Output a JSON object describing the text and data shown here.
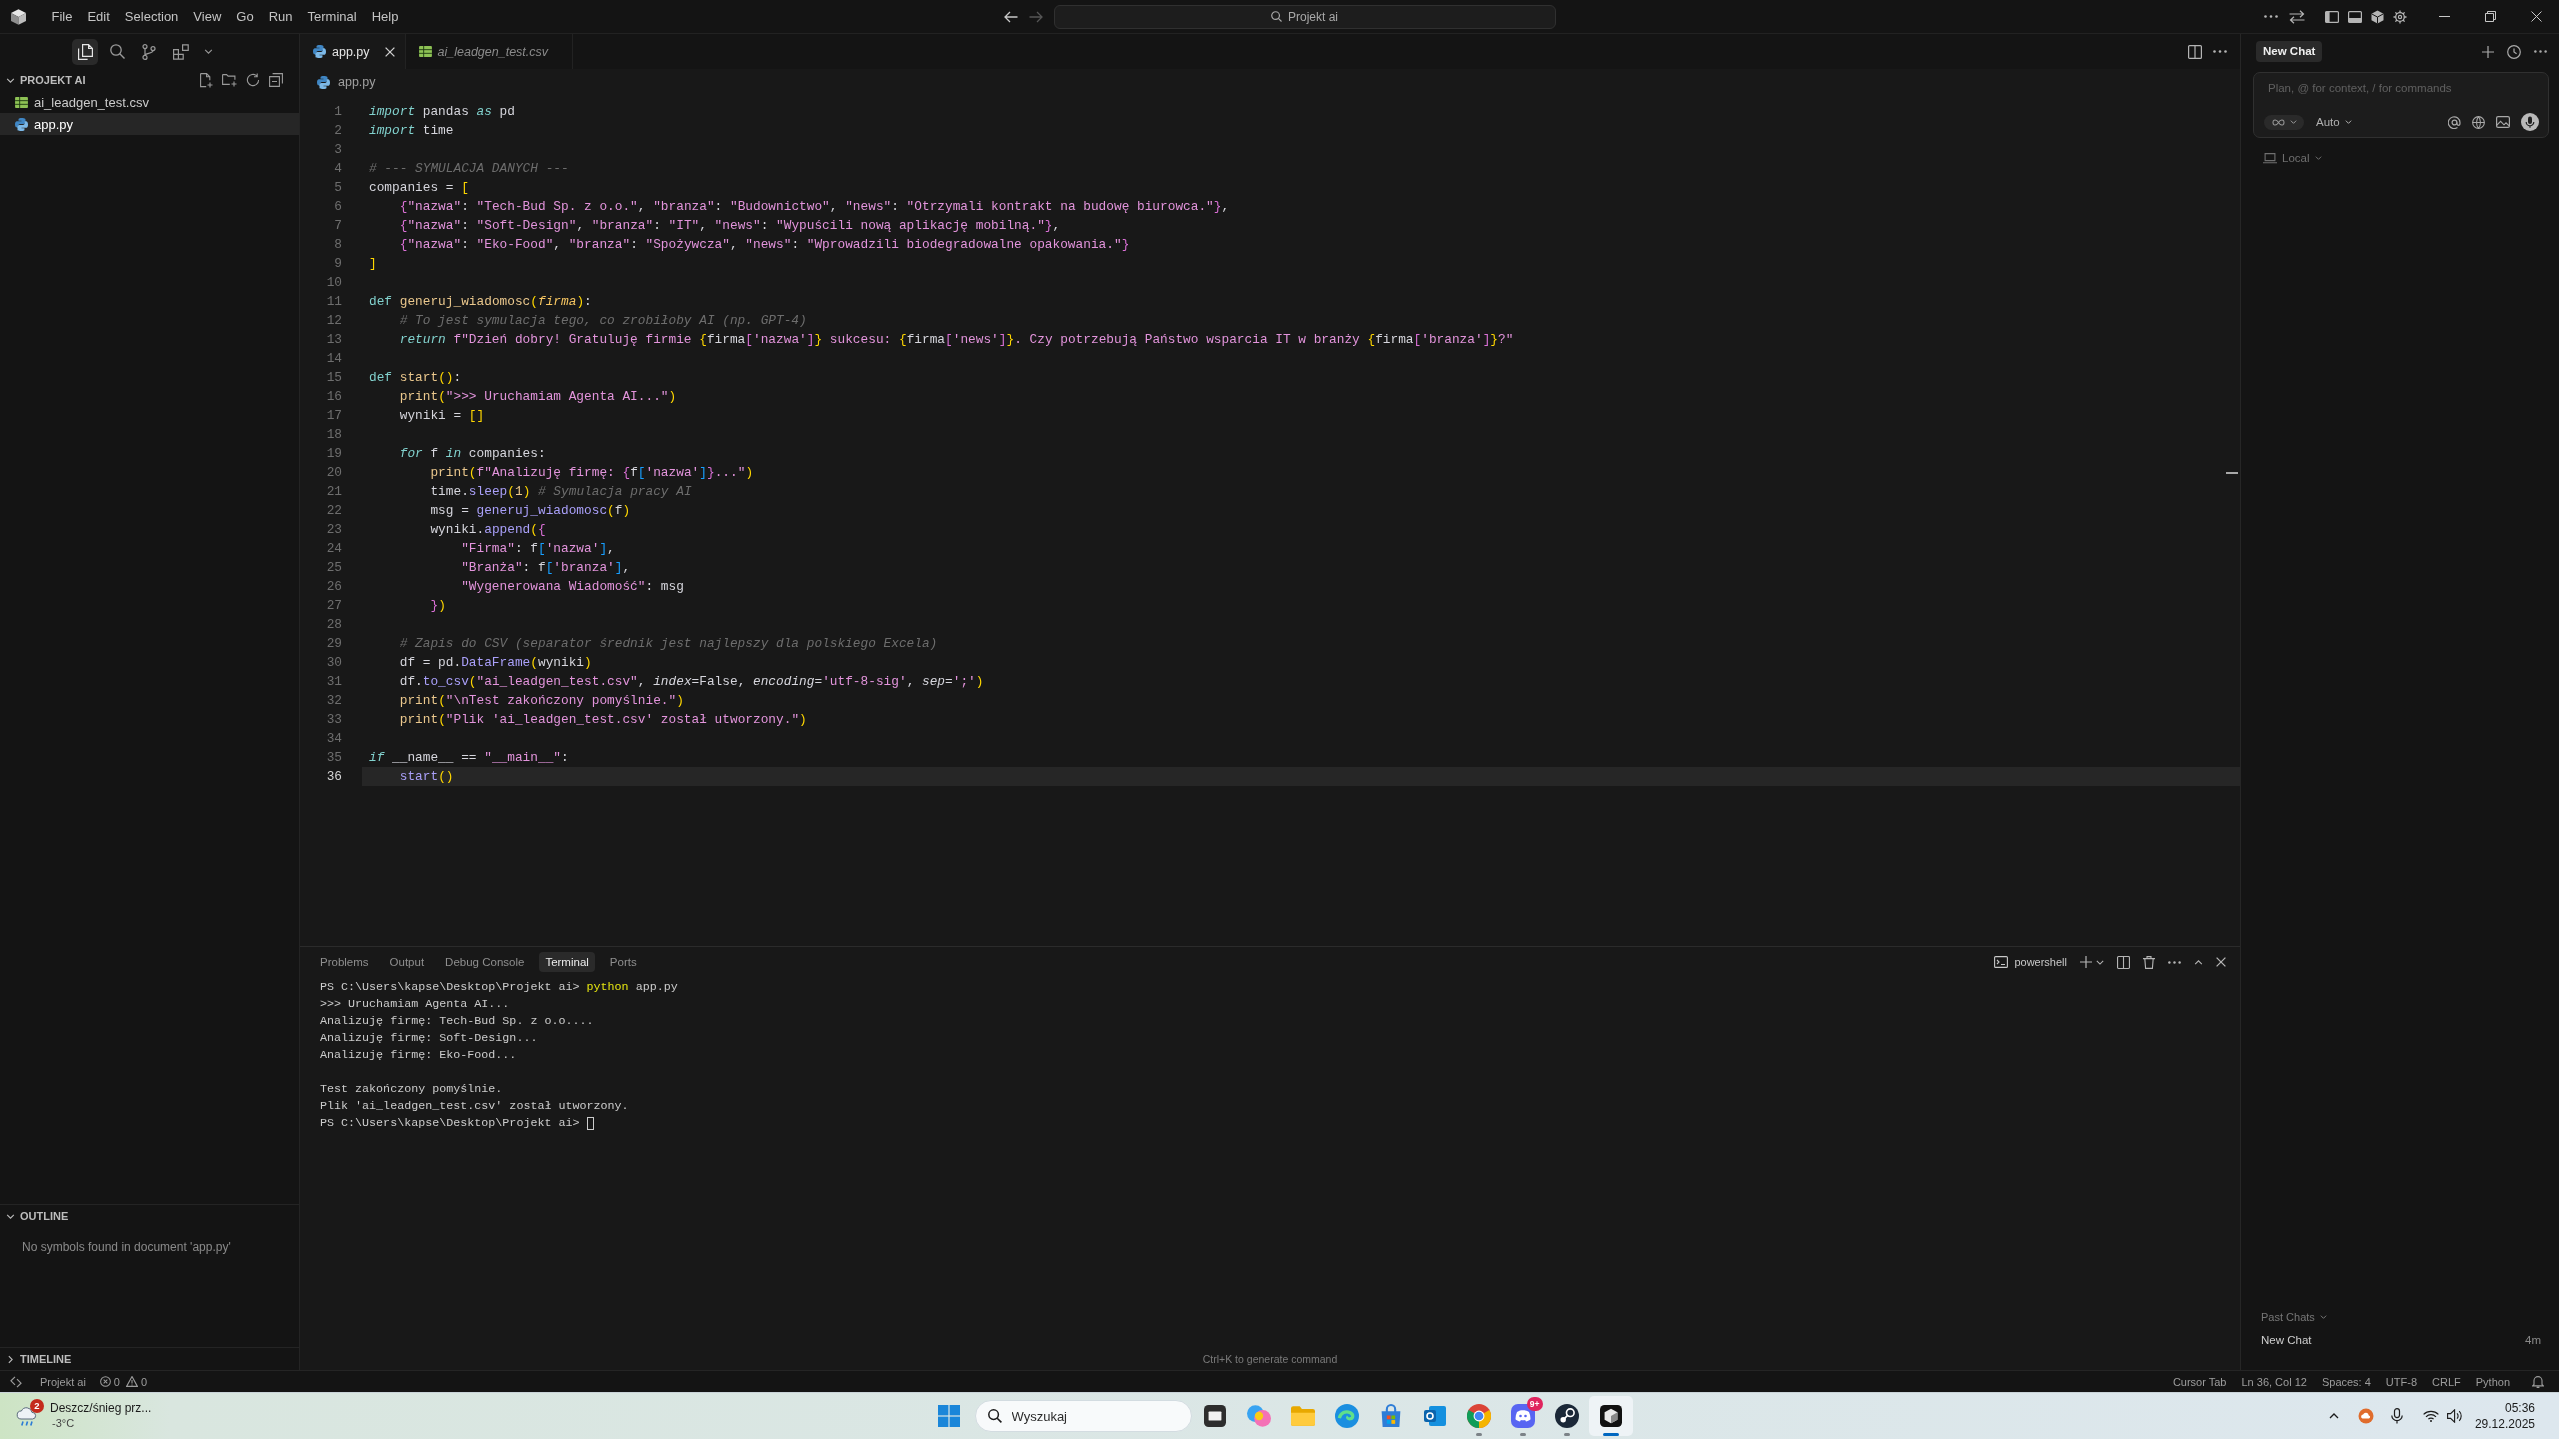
{
  "title_bar": {
    "menu": [
      "File",
      "Edit",
      "Selection",
      "View",
      "Go",
      "Run",
      "Terminal",
      "Help"
    ],
    "command_center": "Projekt ai"
  },
  "sidebar": {
    "views": [
      {
        "kind": "files",
        "selected": true
      },
      {
        "kind": "search",
        "selected": false
      },
      {
        "kind": "branch",
        "selected": false
      },
      {
        "kind": "blocks",
        "selected": false
      }
    ],
    "explorer": {
      "title": "PROJEKT AI",
      "expanded": true,
      "files": [
        {
          "name": "ai_leadgen_test.csv",
          "kind": "csv",
          "selected": false
        },
        {
          "name": "app.py",
          "kind": "python",
          "selected": true
        }
      ]
    },
    "outline": {
      "title": "OUTLINE",
      "expanded": true,
      "message": "No symbols found in document 'app.py'"
    },
    "timeline": {
      "title": "TIMELINE",
      "expanded": false
    }
  },
  "editor": {
    "tabs": [
      {
        "label": "app.py",
        "kind": "python",
        "selected": true,
        "preview": false
      },
      {
        "label": "ai_leadgen_test.csv",
        "kind": "csv",
        "selected": false,
        "preview": true
      }
    ],
    "breadcrumb": {
      "label": "app.py",
      "kind": "python"
    },
    "lines": [
      {
        "number": "1",
        "current": false,
        "tokens": [
          {
            "kind": "kw",
            "text": "import"
          },
          {
            "kind": "p",
            "text": " pandas "
          },
          {
            "kind": "kw",
            "text": "as"
          },
          {
            "kind": "p",
            "text": " pd"
          }
        ]
      },
      {
        "number": "2",
        "current": false,
        "tokens": [
          {
            "kind": "kw",
            "text": "import"
          },
          {
            "kind": "p",
            "text": " time"
          }
        ]
      },
      {
        "number": "3",
        "current": false
      },
      {
        "number": "4",
        "current": false,
        "tokens": [
          {
            "kind": "com",
            "text": "# --- SYMULACJA DANYCH ---"
          }
        ]
      },
      {
        "number": "5",
        "current": false,
        "tokens": [
          {
            "kind": "p",
            "text": "companies = "
          },
          {
            "kind": "b1",
            "text": "["
          }
        ]
      },
      {
        "number": "6",
        "current": false,
        "tokens": [
          {
            "kind": "b2",
            "text": "    {"
          },
          {
            "kind": "str",
            "text": "\"nazwa\""
          },
          {
            "kind": "p",
            "text": ": "
          },
          {
            "kind": "str",
            "text": "\"Tech-Bud Sp. z o.o.\""
          },
          {
            "kind": "p",
            "text": ", "
          },
          {
            "kind": "str",
            "text": "\"branza\""
          },
          {
            "kind": "p",
            "text": ": "
          },
          {
            "kind": "str",
            "text": "\"Budownictwo\""
          },
          {
            "kind": "p",
            "text": ", "
          },
          {
            "kind": "str",
            "text": "\"news\""
          },
          {
            "kind": "p",
            "text": ": "
          },
          {
            "kind": "str",
            "text": "\"Otrzymali kontrakt na budowę biurowca.\""
          },
          {
            "kind": "b2",
            "text": "}"
          },
          {
            "kind": "p",
            "text": ","
          }
        ]
      },
      {
        "number": "7",
        "current": false,
        "tokens": [
          {
            "kind": "b2",
            "text": "    {"
          },
          {
            "kind": "str",
            "text": "\"nazwa\""
          },
          {
            "kind": "p",
            "text": ": "
          },
          {
            "kind": "str",
            "text": "\"Soft-Design\""
          },
          {
            "kind": "p",
            "text": ", "
          },
          {
            "kind": "str",
            "text": "\"branza\""
          },
          {
            "kind": "p",
            "text": ": "
          },
          {
            "kind": "str",
            "text": "\"IT\""
          },
          {
            "kind": "p",
            "text": ", "
          },
          {
            "kind": "str",
            "text": "\"news\""
          },
          {
            "kind": "p",
            "text": ": "
          },
          {
            "kind": "str",
            "text": "\"Wypuścili nową aplikację mobilną.\""
          },
          {
            "kind": "b2",
            "text": "}"
          },
          {
            "kind": "p",
            "text": ","
          }
        ]
      },
      {
        "number": "8",
        "current": false,
        "tokens": [
          {
            "kind": "b2",
            "text": "    {"
          },
          {
            "kind": "str",
            "text": "\"nazwa\""
          },
          {
            "kind": "p",
            "text": ": "
          },
          {
            "kind": "str",
            "text": "\"Eko-Food\""
          },
          {
            "kind": "p",
            "text": ", "
          },
          {
            "kind": "str",
            "text": "\"branza\""
          },
          {
            "kind": "p",
            "text": ": "
          },
          {
            "kind": "str",
            "text": "\"Spożywcza\""
          },
          {
            "kind": "p",
            "text": ", "
          },
          {
            "kind": "str",
            "text": "\"news\""
          },
          {
            "kind": "p",
            "text": ": "
          },
          {
            "kind": "str",
            "text": "\"Wprowadzili biodegradowalne opakowania.\""
          },
          {
            "kind": "b2",
            "text": "}"
          }
        ]
      },
      {
        "number": "9",
        "current": false,
        "tokens": [
          {
            "kind": "b1",
            "text": "]"
          }
        ]
      },
      {
        "number": "10",
        "current": false
      },
      {
        "number": "11",
        "current": false,
        "tokens": [
          {
            "kind": "def",
            "text": "def"
          },
          {
            "kind": "fn",
            "text": " generuj_wiadomosc"
          },
          {
            "kind": "b1",
            "text": "("
          },
          {
            "kind": "par",
            "text": "firma"
          },
          {
            "kind": "b1",
            "text": ")"
          },
          {
            "kind": "p",
            "text": ":"
          }
        ]
      },
      {
        "number": "12",
        "current": false,
        "tokens": [
          {
            "kind": "com",
            "text": "    # To jest symulacja tego, co zrobiłoby AI (np. GPT-4)"
          }
        ]
      },
      {
        "number": "13",
        "current": false,
        "tokens": [
          {
            "kind": "kw",
            "text": "    return"
          },
          {
            "kind": "str",
            "text": " f\"Dzień dobry! Gratuluję firmie "
          },
          {
            "kind": "b1",
            "text": "{"
          },
          {
            "kind": "p",
            "text": "firma"
          },
          {
            "kind": "b2",
            "text": "["
          },
          {
            "kind": "str",
            "text": "'nazwa'"
          },
          {
            "kind": "b2",
            "text": "]"
          },
          {
            "kind": "b1",
            "text": "}"
          },
          {
            "kind": "str",
            "text": " sukcesu: "
          },
          {
            "kind": "b1",
            "text": "{"
          },
          {
            "kind": "p",
            "text": "firma"
          },
          {
            "kind": "b2",
            "text": "["
          },
          {
            "kind": "str",
            "text": "'news'"
          },
          {
            "kind": "b2",
            "text": "]"
          },
          {
            "kind": "b1",
            "text": "}"
          },
          {
            "kind": "str",
            "text": ". Czy potrzebują Państwo wsparcia IT w branży "
          },
          {
            "kind": "b1",
            "text": "{"
          },
          {
            "kind": "p",
            "text": "firma"
          },
          {
            "kind": "b2",
            "text": "["
          },
          {
            "kind": "str",
            "text": "'branza'"
          },
          {
            "kind": "b2",
            "text": "]"
          },
          {
            "kind": "b1",
            "text": "}"
          },
          {
            "kind": "str",
            "text": "?\""
          }
        ]
      },
      {
        "number": "14",
        "current": false
      },
      {
        "number": "15",
        "current": false,
        "tokens": [
          {
            "kind": "def",
            "text": "def"
          },
          {
            "kind": "fn",
            "text": " start"
          },
          {
            "kind": "b1",
            "text": "()"
          },
          {
            "kind": "p",
            "text": ":"
          }
        ]
      },
      {
        "number": "16",
        "current": false,
        "tokens": [
          {
            "kind": "fn",
            "text": "    print"
          },
          {
            "kind": "b1",
            "text": "("
          },
          {
            "kind": "str",
            "text": "\">>> Uruchamiam Agenta AI...\""
          },
          {
            "kind": "b1",
            "text": ")"
          }
        ]
      },
      {
        "number": "17",
        "current": false,
        "tokens": [
          {
            "kind": "p",
            "text": "    wyniki = "
          },
          {
            "kind": "b1",
            "text": "[]"
          }
        ]
      },
      {
        "number": "18",
        "current": false
      },
      {
        "number": "19",
        "current": false,
        "tokens": [
          {
            "kind": "kw",
            "text": "    for"
          },
          {
            "kind": "p",
            "text": " f "
          },
          {
            "kind": "kw",
            "text": "in"
          },
          {
            "kind": "p",
            "text": " companies:"
          }
        ]
      },
      {
        "number": "20",
        "current": false,
        "tokens": [
          {
            "kind": "fn",
            "text": "        print"
          },
          {
            "kind": "b1",
            "text": "("
          },
          {
            "kind": "str",
            "text": "f\"Analizuję firmę: "
          },
          {
            "kind": "b2",
            "text": "{"
          },
          {
            "kind": "p",
            "text": "f"
          },
          {
            "kind": "b3",
            "text": "["
          },
          {
            "kind": "str",
            "text": "'nazwa'"
          },
          {
            "kind": "b3",
            "text": "]"
          },
          {
            "kind": "b2",
            "text": "}"
          },
          {
            "kind": "str",
            "text": "...\""
          },
          {
            "kind": "b1",
            "text": ")"
          }
        ]
      },
      {
        "number": "21",
        "current": false,
        "tokens": [
          {
            "kind": "p",
            "text": "        time."
          },
          {
            "kind": "call",
            "text": "sleep"
          },
          {
            "kind": "b1",
            "text": "("
          },
          {
            "kind": "num",
            "text": "1"
          },
          {
            "kind": "b1",
            "text": ")"
          },
          {
            "kind": "com",
            "text": " # Symulacja pracy AI"
          }
        ]
      },
      {
        "number": "22",
        "current": false,
        "tokens": [
          {
            "kind": "p",
            "text": "        msg = "
          },
          {
            "kind": "call",
            "text": "generuj_wiadomosc"
          },
          {
            "kind": "b1",
            "text": "("
          },
          {
            "kind": "p",
            "text": "f"
          },
          {
            "kind": "b1",
            "text": ")"
          }
        ]
      },
      {
        "number": "23",
        "current": false,
        "tokens": [
          {
            "kind": "p",
            "text": "        wyniki."
          },
          {
            "kind": "call",
            "text": "append"
          },
          {
            "kind": "b1",
            "text": "("
          },
          {
            "kind": "b2",
            "text": "{"
          }
        ]
      },
      {
        "number": "24",
        "current": false,
        "tokens": [
          {
            "kind": "str",
            "text": "            \"Firma\""
          },
          {
            "kind": "p",
            "text": ": f"
          },
          {
            "kind": "b3",
            "text": "["
          },
          {
            "kind": "str",
            "text": "'nazwa'"
          },
          {
            "kind": "b3",
            "text": "]"
          },
          {
            "kind": "p",
            "text": ","
          }
        ]
      },
      {
        "number": "25",
        "current": false,
        "tokens": [
          {
            "kind": "str",
            "text": "            \"Branża\""
          },
          {
            "kind": "p",
            "text": ": f"
          },
          {
            "kind": "b3",
            "text": "["
          },
          {
            "kind": "str",
            "text": "'branza'"
          },
          {
            "kind": "b3",
            "text": "]"
          },
          {
            "kind": "p",
            "text": ","
          }
        ]
      },
      {
        "number": "26",
        "current": false,
        "tokens": [
          {
            "kind": "str",
            "text": "            \"Wygenerowana Wiadomość\""
          },
          {
            "kind": "p",
            "text": ": msg"
          }
        ]
      },
      {
        "number": "27",
        "current": false,
        "tokens": [
          {
            "kind": "b2",
            "text": "        }"
          },
          {
            "kind": "b1",
            "text": ")"
          }
        ]
      },
      {
        "number": "28",
        "current": false
      },
      {
        "number": "29",
        "current": false,
        "tokens": [
          {
            "kind": "com",
            "text": "    # Zapis do CSV (separator średnik jest najlepszy dla polskiego Excela)"
          }
        ]
      },
      {
        "number": "30",
        "current": false,
        "tokens": [
          {
            "kind": "p",
            "text": "    df = pd."
          },
          {
            "kind": "call",
            "text": "DataFrame"
          },
          {
            "kind": "b1",
            "text": "("
          },
          {
            "kind": "p",
            "text": "wyniki"
          },
          {
            "kind": "b1",
            "text": ")"
          }
        ]
      },
      {
        "number": "31",
        "current": false,
        "tokens": [
          {
            "kind": "p",
            "text": "    df."
          },
          {
            "kind": "call",
            "text": "to_csv"
          },
          {
            "kind": "b1",
            "text": "("
          },
          {
            "kind": "str",
            "text": "\"ai_leadgen_test.csv\""
          },
          {
            "kind": "p",
            "text": ", "
          },
          {
            "kind": "arg",
            "text": "index"
          },
          {
            "kind": "p",
            "text": "=False, "
          },
          {
            "kind": "arg",
            "text": "encoding"
          },
          {
            "kind": "p",
            "text": "="
          },
          {
            "kind": "str",
            "text": "'utf-8-sig'"
          },
          {
            "kind": "p",
            "text": ", "
          },
          {
            "kind": "arg",
            "text": "sep"
          },
          {
            "kind": "p",
            "text": "="
          },
          {
            "kind": "str",
            "text": "';'"
          },
          {
            "kind": "b1",
            "text": ")"
          }
        ]
      },
      {
        "number": "32",
        "current": false,
        "tokens": [
          {
            "kind": "fn",
            "text": "    print"
          },
          {
            "kind": "b1",
            "text": "("
          },
          {
            "kind": "str",
            "text": "\"\\nTest zakończony pomyślnie.\""
          },
          {
            "kind": "b1",
            "text": ")"
          }
        ]
      },
      {
        "number": "33",
        "current": false,
        "tokens": [
          {
            "kind": "fn",
            "text": "    print"
          },
          {
            "kind": "b1",
            "text": "("
          },
          {
            "kind": "str",
            "text": "\"Plik 'ai_leadgen_test.csv' został utworzony.\""
          },
          {
            "kind": "b1",
            "text": ")"
          }
        ]
      },
      {
        "number": "34",
        "current": false
      },
      {
        "number": "35",
        "current": false,
        "tokens": [
          {
            "kind": "kw",
            "text": "if"
          },
          {
            "kind": "p",
            "text": " __name__ == "
          },
          {
            "kind": "str",
            "text": "\"__main__\""
          },
          {
            "kind": "p",
            "text": ":"
          }
        ]
      },
      {
        "number": "36",
        "current": true,
        "tokens": [
          {
            "kind": "call",
            "text": "    start"
          },
          {
            "kind": "b1",
            "text": "()"
          }
        ]
      }
    ]
  },
  "panel": {
    "tabs": [
      {
        "label": "Problems",
        "selected": false
      },
      {
        "label": "Output",
        "selected": false
      },
      {
        "label": "Debug Console",
        "selected": false
      },
      {
        "label": "Terminal",
        "selected": true
      },
      {
        "label": "Ports",
        "selected": false
      }
    ],
    "shell": "powershell",
    "terminal": [
      {
        "kind": "text",
        "cursor": false,
        "segments": [
          {
            "kind": "text",
            "text": "PS C:\\Users\\kapse\\Desktop\\Projekt ai> "
          },
          {
            "kind": "command",
            "text": "python"
          },
          {
            "kind": "text",
            "text": " app.py"
          }
        ]
      },
      {
        "kind": "text",
        "cursor": false,
        "segments": [
          {
            "kind": "text",
            "text": ">>> Uruchamiam Agenta AI..."
          }
        ]
      },
      {
        "kind": "text",
        "cursor": false,
        "segments": [
          {
            "kind": "text",
            "text": "Analizuję firmę: Tech-Bud Sp. z o.o...."
          }
        ]
      },
      {
        "kind": "text",
        "cursor": false,
        "segments": [
          {
            "kind": "text",
            "text": "Analizuję firmę: Soft-Design..."
          }
        ]
      },
      {
        "kind": "text",
        "cursor": false,
        "segments": [
          {
            "kind": "text",
            "text": "Analizuję firmę: Eko-Food..."
          }
        ]
      },
      {
        "kind": "blank"
      },
      {
        "kind": "text",
        "cursor": false,
        "segments": [
          {
            "kind": "text",
            "text": "Test zakończony pomyślnie."
          }
        ]
      },
      {
        "kind": "text",
        "cursor": false,
        "segments": [
          {
            "kind": "text",
            "text": "Plik 'ai_leadgen_test.csv' został utworzony."
          }
        ]
      },
      {
        "kind": "text",
        "cursor": true,
        "segments": [
          {
            "kind": "text",
            "text": "PS C:\\Users\\kapse\\Desktop\\Projekt ai> "
          }
        ]
      }
    ],
    "hint": "Ctrl+K to generate command"
  },
  "chat": {
    "tab": "New Chat",
    "placeholder": "Plan, @ for context, / for commands",
    "mode": "Auto",
    "location": "Local",
    "past_chats": {
      "title": "Past Chats",
      "items": [
        {
          "title": "New Chat",
          "age": "4m"
        }
      ]
    }
  },
  "status_bar": {
    "workspace": "Projekt ai",
    "errors": "0",
    "warnings": "0",
    "items": [
      "Cursor Tab",
      "Ln 36, Col 12",
      "Spaces: 4",
      "UTF-8",
      "CRLF",
      "Python"
    ]
  },
  "taskbar": {
    "weather": {
      "badge": "2",
      "summary": "Deszcz/śnieg prz...",
      "temperature": "-3°C"
    },
    "search": {
      "placeholder": "Wyszukaj"
    },
    "apps": [
      {
        "kind": "tile",
        "running": false,
        "active": false
      },
      {
        "kind": "swirl",
        "running": false,
        "active": false
      },
      {
        "kind": "folder",
        "running": false,
        "active": false
      },
      {
        "kind": "wave",
        "running": false,
        "active": false
      },
      {
        "kind": "bag",
        "running": false,
        "active": false
      },
      {
        "kind": "mail",
        "running": false,
        "active": false
      },
      {
        "kind": "ring",
        "running": true,
        "active": false
      },
      {
        "kind": "chat",
        "running": true,
        "active": false,
        "badge": "9+"
      },
      {
        "kind": "disc",
        "running": true,
        "active": false
      },
      {
        "kind": "cube",
        "running": true,
        "active": true
      }
    ],
    "clock": {
      "time": "05:36",
      "date": "29.12.2025"
    }
  }
}
